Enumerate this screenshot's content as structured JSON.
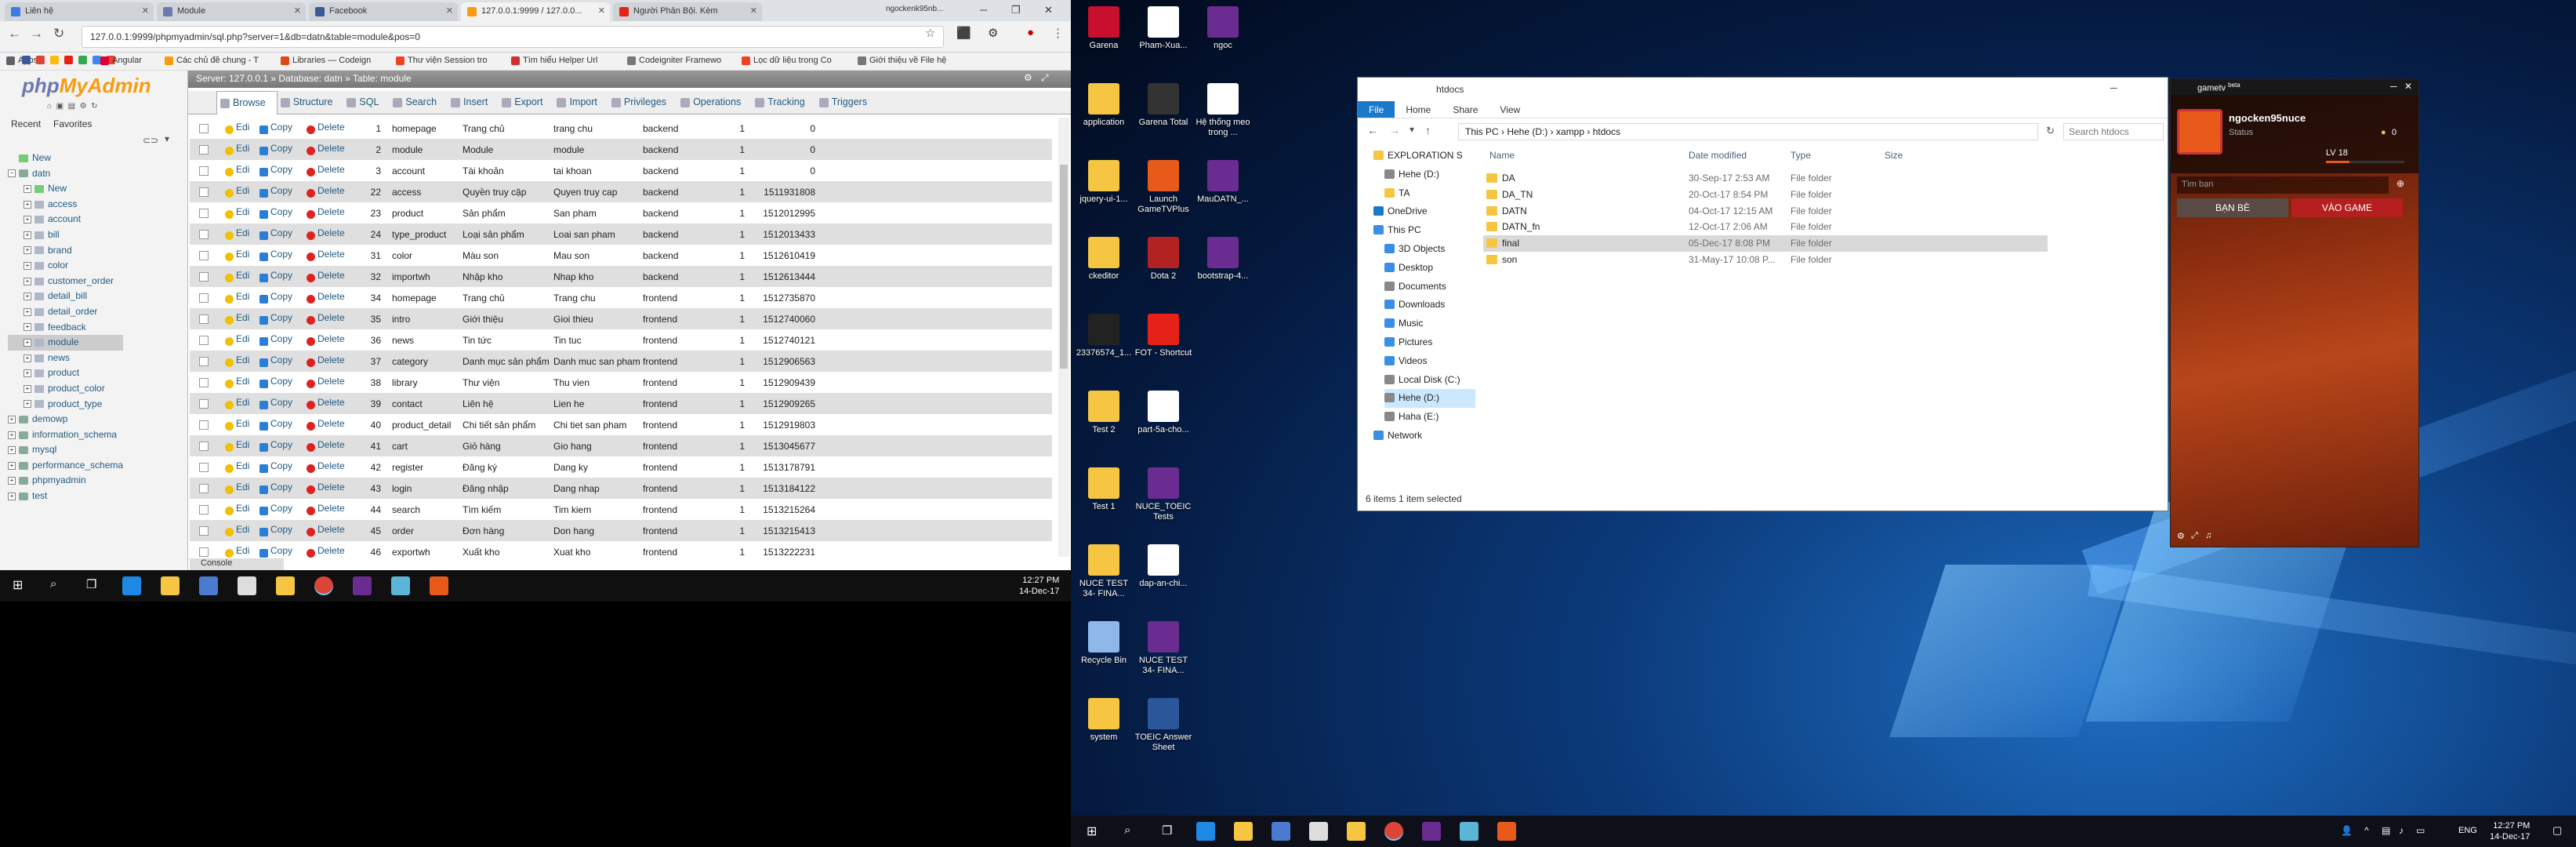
{
  "browser": {
    "tabs": [
      {
        "label": "Liên hệ",
        "color": "#3b7be6",
        "active": false
      },
      {
        "label": "Module",
        "color": "#6c78af",
        "active": false
      },
      {
        "label": "Facebook",
        "color": "#3b5998",
        "active": false
      },
      {
        "label": "127.0.0.1:9999 / 127.0.0...",
        "color": "#f89c0e",
        "active": true
      },
      {
        "label": "Người Phản Bội. Kèm",
        "color": "#e62117",
        "active": false
      }
    ],
    "profile": "ngockenk95nb...",
    "url": "127.0.0.1:9999/phpmyadmin/sql.php?server=1&db=datn&table=module&pos=0",
    "bookmarks": [
      {
        "label": "Apps",
        "color": "#5f6368"
      },
      {
        "label": "",
        "color": "#3b5998"
      },
      {
        "label": "",
        "color": "#db4437"
      },
      {
        "label": "",
        "color": "#fbbc05"
      },
      {
        "label": "",
        "color": "#e62117"
      },
      {
        "label": "",
        "color": "#34a853"
      },
      {
        "label": "",
        "color": "#4285f4"
      },
      {
        "label": "",
        "color": "#ea4335"
      },
      {
        "label": "Angular",
        "color": "#dd0031"
      },
      {
        "label": "Các chủ đề chung - T",
        "color": "#f89c0e"
      },
      {
        "label": "Libraries — Codeign",
        "color": "#dd4814"
      },
      {
        "label": "Thư viện Session tro",
        "color": "#ee4323"
      },
      {
        "label": "Tìm hiểu Helper Url",
        "color": "#d32f2f"
      },
      {
        "label": "Codeigniter Framewo",
        "color": "#777777"
      },
      {
        "label": "Lọc dữ liệu trong Co",
        "color": "#ee4323"
      },
      {
        "label": "Giới thiệu về File hệ",
        "color": "#777777"
      }
    ]
  },
  "pma": {
    "logo_a": "php",
    "logo_b": "MyAdmin",
    "nav_tabs": [
      "Recent",
      "Favorites"
    ],
    "tree": [
      {
        "label": "New",
        "level": 0,
        "kind": "new"
      },
      {
        "label": "datn",
        "level": 0,
        "kind": "db-open"
      },
      {
        "label": "New",
        "level": 1,
        "kind": "new"
      },
      {
        "label": "access",
        "level": 1,
        "kind": "table"
      },
      {
        "label": "account",
        "level": 1,
        "kind": "table"
      },
      {
        "label": "bill",
        "level": 1,
        "kind": "table"
      },
      {
        "label": "brand",
        "level": 1,
        "kind": "table"
      },
      {
        "label": "color",
        "level": 1,
        "kind": "table"
      },
      {
        "label": "customer_order",
        "level": 1,
        "kind": "table"
      },
      {
        "label": "detail_bill",
        "level": 1,
        "kind": "table"
      },
      {
        "label": "detail_order",
        "level": 1,
        "kind": "table"
      },
      {
        "label": "feedback",
        "level": 1,
        "kind": "table"
      },
      {
        "label": "module",
        "level": 1,
        "kind": "table-sel"
      },
      {
        "label": "news",
        "level": 1,
        "kind": "table"
      },
      {
        "label": "product",
        "level": 1,
        "kind": "table"
      },
      {
        "label": "product_color",
        "level": 1,
        "kind": "table"
      },
      {
        "label": "product_type",
        "level": 1,
        "kind": "table"
      },
      {
        "label": "demowp",
        "level": 0,
        "kind": "db"
      },
      {
        "label": "information_schema",
        "level": 0,
        "kind": "db"
      },
      {
        "label": "mysql",
        "level": 0,
        "kind": "db"
      },
      {
        "label": "performance_schema",
        "level": 0,
        "kind": "db"
      },
      {
        "label": "phpmyadmin",
        "level": 0,
        "kind": "db"
      },
      {
        "label": "test",
        "level": 0,
        "kind": "db"
      }
    ],
    "breadcrumb": "Server: 127.0.0.1  »  Database: datn  »  Table: module",
    "tabs": [
      "Browse",
      "Structure",
      "SQL",
      "Search",
      "Insert",
      "Export",
      "Import",
      "Privileges",
      "Operations",
      "Tracking",
      "Triggers"
    ],
    "actions": {
      "edit": "Edit",
      "copy": "Copy",
      "delete": "Delete"
    },
    "rows": [
      [
        "1",
        "homepage",
        "Trang chủ",
        "trang chu",
        "backend",
        "1",
        "0"
      ],
      [
        "2",
        "module",
        "Module",
        "module",
        "backend",
        "1",
        "0"
      ],
      [
        "3",
        "account",
        "Tài khoản",
        "tai khoan",
        "backend",
        "1",
        "0"
      ],
      [
        "22",
        "access",
        "Quyền truy cập",
        "Quyen truy cap",
        "backend",
        "1",
        "1511931808"
      ],
      [
        "23",
        "product",
        "Sản phẩm",
        "San pham",
        "backend",
        "1",
        "1512012995"
      ],
      [
        "24",
        "type_product",
        "Loại sản phẩm",
        "Loai san pham",
        "backend",
        "1",
        "1512013433"
      ],
      [
        "31",
        "color",
        "Màu son",
        "Mau son",
        "backend",
        "1",
        "1512610419"
      ],
      [
        "32",
        "importwh",
        "Nhập kho",
        "Nhap kho",
        "backend",
        "1",
        "1512613444"
      ],
      [
        "34",
        "homepage",
        "Trang chủ",
        "Trang chu",
        "frontend",
        "1",
        "1512735870"
      ],
      [
        "35",
        "intro",
        "Giới thiệu",
        "Gioi thieu",
        "frontend",
        "1",
        "1512740060"
      ],
      [
        "36",
        "news",
        "Tin tức",
        "Tin tuc",
        "frontend",
        "1",
        "1512740121"
      ],
      [
        "37",
        "category",
        "Danh mục sản phẩm",
        "Danh muc san pham",
        "frontend",
        "1",
        "1512906563"
      ],
      [
        "38",
        "library",
        "Thư viện",
        "Thu vien",
        "frontend",
        "1",
        "1512909439"
      ],
      [
        "39",
        "contact",
        "Liên hệ",
        "Lien he",
        "frontend",
        "1",
        "1512909265"
      ],
      [
        "40",
        "product_detail",
        "Chi tiết sản phẩm",
        "Chi tiet san pham",
        "frontend",
        "1",
        "1512919803"
      ],
      [
        "41",
        "cart",
        "Giỏ hàng",
        "Gio hang",
        "frontend",
        "1",
        "1513045677"
      ],
      [
        "42",
        "register",
        "Đăng ký",
        "Dang ky",
        "frontend",
        "1",
        "1513178791"
      ],
      [
        "43",
        "login",
        "Đăng nhập",
        "Dang nhap",
        "frontend",
        "1",
        "1513184122"
      ],
      [
        "44",
        "search",
        "Tìm kiếm",
        "Tim kiem",
        "frontend",
        "1",
        "1513215264"
      ],
      [
        "45",
        "order",
        "Đơn hàng",
        "Don hang",
        "frontend",
        "1",
        "1513215413"
      ],
      [
        "46",
        "exportwh",
        "Xuất kho",
        "Xuat kho",
        "frontend",
        "1",
        "1513222231"
      ]
    ],
    "console": "Console"
  },
  "taskbar_left": {
    "time": "12:27 PM",
    "date": "14-Dec-17"
  },
  "desktop_icons": [
    {
      "label": "Garena",
      "color": "#c8102e"
    },
    {
      "label": "Pham-Xua...",
      "color": "#ffffff"
    },
    {
      "label": "ngoc",
      "color": "#6a2c91"
    },
    {
      "label": "application",
      "color": "#f6c643"
    },
    {
      "label": "Garena Total",
      "color": "#333333"
    },
    {
      "label": "Hệ thống meo trong ...",
      "color": "#ffffff"
    },
    {
      "label": "jquery-ui-1...",
      "color": "#f6c643"
    },
    {
      "label": "Launch GameTVPlus",
      "color": "#e85a1a"
    },
    {
      "label": "MauDATN_...",
      "color": "#6a2c91"
    },
    {
      "label": "ckeditor",
      "color": "#f6c643"
    },
    {
      "label": "Dota 2",
      "color": "#b22222"
    },
    {
      "label": "bootstrap-4...",
      "color": "#6a2c91"
    },
    {
      "label": "23376574_1...",
      "color": "#222222"
    },
    {
      "label": "FOT - Shortcut",
      "color": "#e62117"
    },
    {
      "label": "Test 2",
      "color": "#f6c643"
    },
    {
      "label": "part-5a-cho...",
      "color": "#ffffff"
    },
    {
      "label": "Test 1",
      "color": "#f6c643"
    },
    {
      "label": "NUCE_TOEIC Tests",
      "color": "#6a2c91"
    },
    {
      "label": "NUCE TEST 34- FINA...",
      "color": "#f6c643"
    },
    {
      "label": "dap-an-chi...",
      "color": "#ffffff"
    },
    {
      "label": "Recycle Bin",
      "color": "#8fb8e8"
    },
    {
      "label": "NUCE TEST 34- FINA...",
      "color": "#6a2c91"
    },
    {
      "label": "system",
      "color": "#f6c643"
    },
    {
      "label": "TOEIC Answer Sheet",
      "color": "#2b579a"
    }
  ],
  "explorer": {
    "title": "htdocs",
    "ribbon": [
      "File",
      "Home",
      "Share",
      "View"
    ],
    "path": "This PC  ›  Hehe (D:)  ›  xampp  ›  htdocs",
    "search_placeholder": "Search htdocs",
    "nav": [
      {
        "label": "EXPLORATION S",
        "color": "#f6c643"
      },
      {
        "label": "Hehe (D:)",
        "color": "#888888"
      },
      {
        "label": "TA",
        "color": "#f6c643"
      },
      {
        "label": "OneDrive",
        "color": "#1979ca"
      },
      {
        "label": "This PC",
        "color": "#3a8ee6"
      },
      {
        "label": "3D Objects",
        "color": "#3a8ee6"
      },
      {
        "label": "Desktop",
        "color": "#3a8ee6"
      },
      {
        "label": "Documents",
        "color": "#888888"
      },
      {
        "label": "Downloads",
        "color": "#3a8ee6"
      },
      {
        "label": "Music",
        "color": "#3a8ee6"
      },
      {
        "label": "Pictures",
        "color": "#3a8ee6"
      },
      {
        "label": "Videos",
        "color": "#3a8ee6"
      },
      {
        "label": "Local Disk (C:)",
        "color": "#888888"
      },
      {
        "label": "Hehe (D:)",
        "color": "#888888"
      },
      {
        "label": "Haha (E:)",
        "color": "#888888"
      },
      {
        "label": "Network",
        "color": "#3a8ee6"
      }
    ],
    "columns": [
      "Name",
      "Date modified",
      "Type",
      "Size"
    ],
    "files": [
      [
        "DA",
        "30-Sep-17 2:53 AM",
        "File folder",
        ""
      ],
      [
        "DA_TN",
        "20-Oct-17 8:54 PM",
        "File folder",
        ""
      ],
      [
        "DATN",
        "04-Oct-17 12:15 AM",
        "File folder",
        ""
      ],
      [
        "DATN_fn",
        "12-Oct-17 2:06 AM",
        "File folder",
        ""
      ],
      [
        "final",
        "05-Dec-17 8:08 PM",
        "File folder",
        ""
      ],
      [
        "son",
        "31-May-17 10:08 P...",
        "File folder",
        ""
      ]
    ],
    "status": "6 items    1 item selected"
  },
  "gametv": {
    "title": "gametv",
    "beta": "beta",
    "username": "ngocken95nuce",
    "status": "Status",
    "level": "LV 18",
    "coins": "0",
    "search_placeholder": "Tìm bạn",
    "friends_button": "BẠN BÈ",
    "play_button": "VÀO GAME"
  },
  "taskbar_right": {
    "lang": "ENG",
    "time": "12:27 PM",
    "date": "14-Dec-17"
  }
}
